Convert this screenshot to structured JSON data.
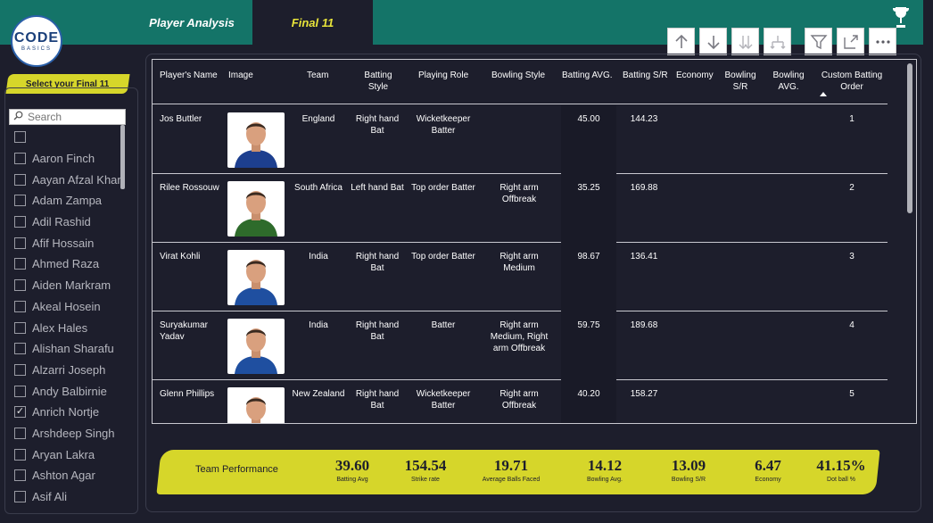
{
  "nav": {
    "tabs": [
      {
        "label": "Player Analysis"
      },
      {
        "label": "Final 11"
      }
    ]
  },
  "logo": {
    "line1": "CODE",
    "line2": "BASICS"
  },
  "toolbar": {
    "icons": [
      "arrow-up-icon",
      "arrow-down-icon",
      "double-arrow-down-icon",
      "hierarchy-icon",
      "filter-icon",
      "focus-mode-icon",
      "more-options-icon"
    ]
  },
  "sidebar": {
    "title": "Select your Final 11",
    "search_placeholder": "Search",
    "items": [
      {
        "label": "",
        "checked": false
      },
      {
        "label": "Aaron Finch",
        "checked": false
      },
      {
        "label": "Aayan Afzal Khan",
        "checked": false
      },
      {
        "label": "Adam Zampa",
        "checked": false
      },
      {
        "label": "Adil Rashid",
        "checked": false
      },
      {
        "label": "Afif Hossain",
        "checked": false
      },
      {
        "label": "Ahmed Raza",
        "checked": false
      },
      {
        "label": "Aiden Markram",
        "checked": false
      },
      {
        "label": "Akeal Hosein",
        "checked": false
      },
      {
        "label": "Alex Hales",
        "checked": false
      },
      {
        "label": "Alishan Sharafu",
        "checked": false
      },
      {
        "label": "Alzarri Joseph",
        "checked": false
      },
      {
        "label": "Andy Balbirnie",
        "checked": false
      },
      {
        "label": "Anrich Nortje",
        "checked": true
      },
      {
        "label": "Arshdeep Singh",
        "checked": false
      },
      {
        "label": "Aryan Lakra",
        "checked": false
      },
      {
        "label": "Ashton Agar",
        "checked": false
      },
      {
        "label": "Asif Ali",
        "checked": false
      }
    ]
  },
  "table": {
    "columns": [
      "Player's Name",
      "Image",
      "Team",
      "Batting Style",
      "Playing Role",
      "Bowling Style",
      "Batting AVG.",
      "Batting S/R",
      "Economy",
      "Bowling S/R",
      "Bowling AVG.",
      "Custom Batting Order"
    ],
    "rows": [
      {
        "name": "Jos Buttler",
        "team": "England",
        "batting_style": "Right hand Bat",
        "role": "Wicketkeeper Batter",
        "bowling_style": "",
        "bat_avg": "45.00",
        "bat_sr": "144.23",
        "economy": "",
        "bowl_sr": "",
        "bowl_avg": "",
        "order": "1",
        "jersey": "#1d3f8f"
      },
      {
        "name": "Rilee Rossouw",
        "team": "South Africa",
        "batting_style": "Left hand Bat",
        "role": "Top order Batter",
        "bowling_style": "Right arm Offbreak",
        "bat_avg": "35.25",
        "bat_sr": "169.88",
        "economy": "",
        "bowl_sr": "",
        "bowl_avg": "",
        "order": "2",
        "jersey": "#2e6b2b"
      },
      {
        "name": "Virat Kohli",
        "team": "India",
        "batting_style": "Right hand Bat",
        "role": "Top order Batter",
        "bowling_style": "Right arm Medium",
        "bat_avg": "98.67",
        "bat_sr": "136.41",
        "economy": "",
        "bowl_sr": "",
        "bowl_avg": "",
        "order": "3",
        "jersey": "#1f4fa0"
      },
      {
        "name": "Suryakumar Yadav",
        "team": "India",
        "batting_style": "Right hand Bat",
        "role": "Batter",
        "bowling_style": "Right arm Medium, Right arm Offbreak",
        "bat_avg": "59.75",
        "bat_sr": "189.68",
        "economy": "",
        "bowl_sr": "",
        "bowl_avg": "",
        "order": "4",
        "jersey": "#1f4fa0"
      },
      {
        "name": "Glenn Phillips",
        "team": "New Zealand",
        "batting_style": "Right hand Bat",
        "role": "Wicketkeeper Batter",
        "bowling_style": "Right arm Offbreak",
        "bat_avg": "40.20",
        "bat_sr": "158.27",
        "economy": "",
        "bowl_sr": "",
        "bowl_avg": "",
        "order": "5",
        "jersey": "#222222"
      }
    ]
  },
  "performance": {
    "title": "Team Performance",
    "kpis": [
      {
        "value": "39.60",
        "label": "Batting Avg"
      },
      {
        "value": "154.54",
        "label": "Strike rate"
      },
      {
        "value": "19.71",
        "label": "Average Balls Faced"
      },
      {
        "value": "14.12",
        "label": "Bowling Avg."
      },
      {
        "value": "13.09",
        "label": "Bowling S/R"
      },
      {
        "value": "6.47",
        "label": "Economy"
      },
      {
        "value": "41.15%",
        "label": "Dot ball %"
      }
    ]
  },
  "colors": {
    "nav": "#147468",
    "background": "#1d1e2c",
    "accent": "#d6d62a",
    "active_tab_text": "#e8e43a"
  }
}
